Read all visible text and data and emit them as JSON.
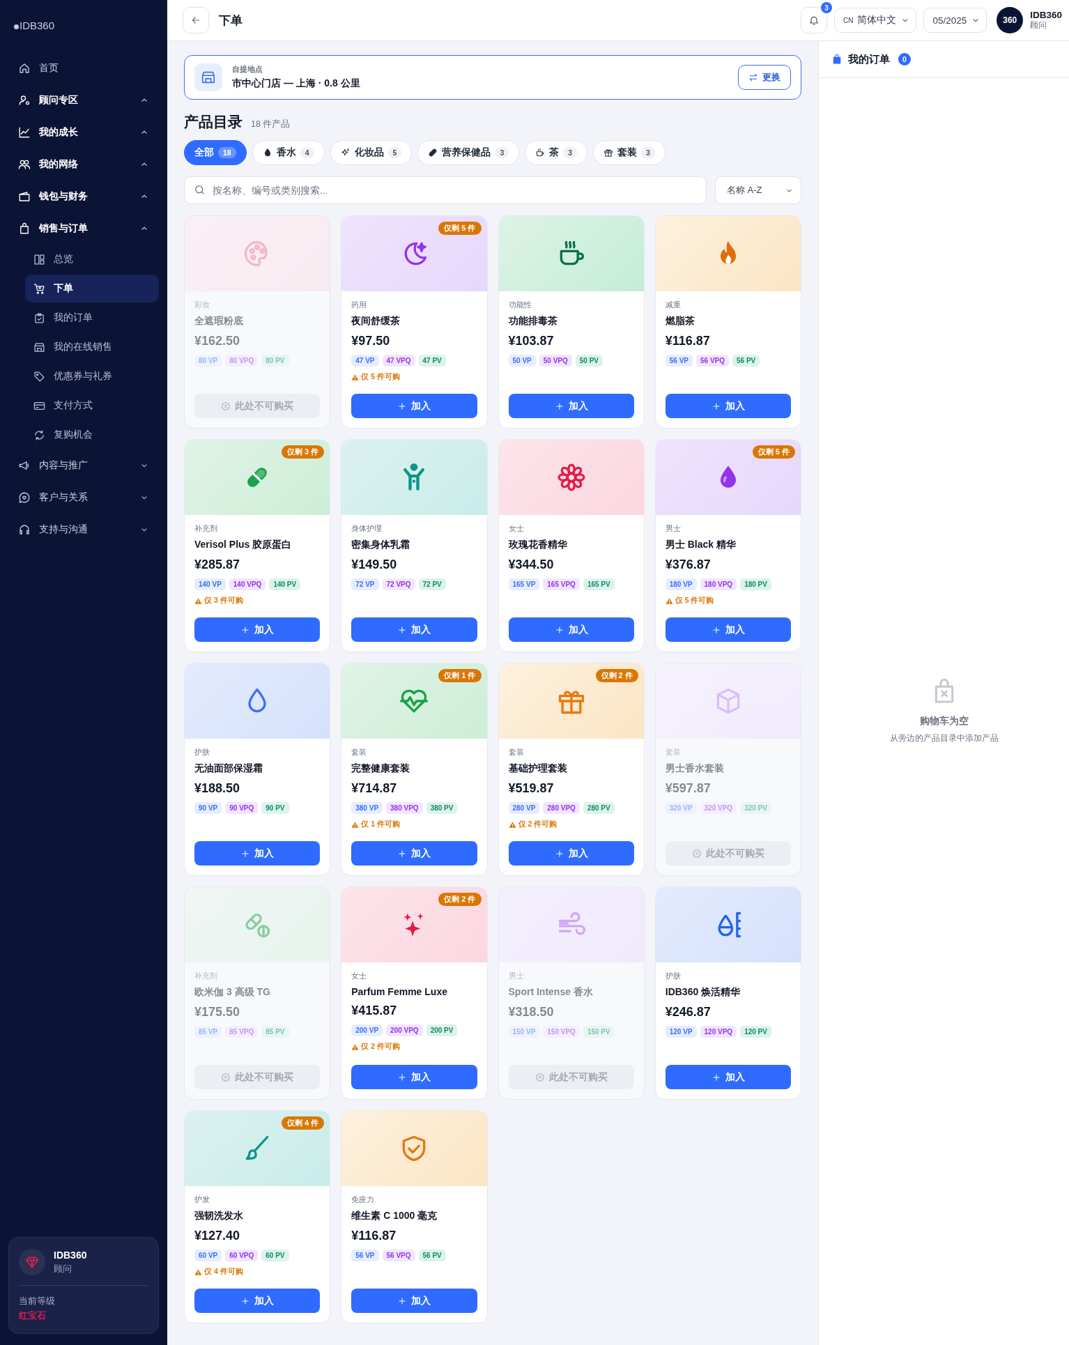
{
  "brand": "IDB360",
  "nav": [
    {
      "label": "首页",
      "kind": "link"
    },
    {
      "label": "顾问专区",
      "kind": "group",
      "expanded": true
    },
    {
      "label": "我的成长",
      "kind": "group",
      "expanded": true
    },
    {
      "label": "我的网络",
      "kind": "group",
      "expanded": true
    },
    {
      "label": "钱包与财务",
      "kind": "group",
      "expanded": true
    },
    {
      "label": "销售与订单",
      "kind": "group",
      "expanded": true,
      "children": [
        {
          "label": "总览",
          "selected": false
        },
        {
          "label": "下单",
          "selected": true
        },
        {
          "label": "我的订单",
          "selected": false
        },
        {
          "label": "我的在线销售",
          "selected": false
        },
        {
          "label": "优惠券与礼券",
          "selected": false
        },
        {
          "label": "支付方式",
          "selected": false
        },
        {
          "label": "复购机会",
          "selected": false
        }
      ]
    },
    {
      "label": "内容与推广",
      "kind": "group",
      "expanded": false
    },
    {
      "label": "客户与关系",
      "kind": "group",
      "expanded": false
    },
    {
      "label": "支持与沟通",
      "kind": "group",
      "expanded": false
    }
  ],
  "profile": {
    "name": "IDB360",
    "role": "顾问",
    "level_label": "当前等级",
    "level": "红宝石"
  },
  "header": {
    "title": "下单",
    "notifications": "3",
    "language_code": "CN",
    "language": "简体中文",
    "period": "05/2025",
    "avatar": "360",
    "user": "IDB360",
    "user_role": "顾问"
  },
  "pickup": {
    "label": "自提地点",
    "location": "市中心门店 — 上海 · 0.8 公里",
    "button": "更换"
  },
  "catalog": {
    "title": "产品目录",
    "count": "18 件产品",
    "search_placeholder": "按名称、编号或类别搜索...",
    "sort": "名称 A-Z"
  },
  "filters": [
    {
      "label": "全部",
      "count": "18",
      "selected": true
    },
    {
      "label": "香水",
      "count": "4",
      "selected": false
    },
    {
      "label": "化妆品",
      "count": "5",
      "selected": false
    },
    {
      "label": "营养保健品",
      "count": "3",
      "selected": false
    },
    {
      "label": "茶",
      "count": "3",
      "selected": false
    },
    {
      "label": "套装",
      "count": "3",
      "selected": false
    }
  ],
  "products": [
    {
      "category": "彩妆",
      "name": "全遮瑕粉底",
      "price": "¥162.50",
      "vp": "80 VP",
      "vpq": "80 VPQ",
      "pv": "80 PV",
      "available": false,
      "button": "此处不可购买"
    },
    {
      "category": "药用",
      "name": "夜间舒缓茶",
      "price": "¥97.50",
      "vp": "47 VP",
      "vpq": "47 VPQ",
      "pv": "47 PV",
      "available": true,
      "badge": "仅剩 5 件",
      "warning": "仅 5 件可购",
      "button": "加入"
    },
    {
      "category": "功能性",
      "name": "功能排毒茶",
      "price": "¥103.87",
      "vp": "50 VP",
      "vpq": "50 VPQ",
      "pv": "50 PV",
      "available": true,
      "button": "加入"
    },
    {
      "category": "减重",
      "name": "燃脂茶",
      "price": "¥116.87",
      "vp": "56 VP",
      "vpq": "56 VPQ",
      "pv": "56 PV",
      "available": true,
      "button": "加入"
    },
    {
      "category": "补充剂",
      "name": "Verisol Plus 胶原蛋白",
      "price": "¥285.87",
      "vp": "140 VP",
      "vpq": "140 VPQ",
      "pv": "140 PV",
      "available": true,
      "badge": "仅剩 3 件",
      "warning": "仅 3 件可购",
      "button": "加入"
    },
    {
      "category": "身体护理",
      "name": "密集身体乳霜",
      "price": "¥149.50",
      "vp": "72 VP",
      "vpq": "72 VPQ",
      "pv": "72 PV",
      "available": true,
      "button": "加入"
    },
    {
      "category": "女士",
      "name": "玫瑰花香精华",
      "price": "¥344.50",
      "vp": "165 VP",
      "vpq": "165 VPQ",
      "pv": "165 PV",
      "available": true,
      "button": "加入"
    },
    {
      "category": "男士",
      "name": "男士 Black 精华",
      "price": "¥376.87",
      "vp": "180 VP",
      "vpq": "180 VPQ",
      "pv": "180 PV",
      "available": true,
      "badge": "仅剩 5 件",
      "warning": "仅 5 件可购",
      "button": "加入"
    },
    {
      "category": "护肤",
      "name": "无油面部保湿霜",
      "price": "¥188.50",
      "vp": "90 VP",
      "vpq": "90 VPQ",
      "pv": "90 PV",
      "available": true,
      "button": "加入"
    },
    {
      "category": "套装",
      "name": "完整健康套装",
      "price": "¥714.87",
      "vp": "380 VP",
      "vpq": "380 VPQ",
      "pv": "380 PV",
      "available": true,
      "badge": "仅剩 1 件",
      "warning": "仅 1 件可购",
      "button": "加入"
    },
    {
      "category": "套装",
      "name": "基础护理套装",
      "price": "¥519.87",
      "vp": "280 VP",
      "vpq": "280 VPQ",
      "pv": "280 PV",
      "available": true,
      "badge": "仅剩 2 件",
      "warning": "仅 2 件可购",
      "button": "加入"
    },
    {
      "category": "套装",
      "name": "男士香水套装",
      "price": "¥597.87",
      "vp": "320 VP",
      "vpq": "320 VPQ",
      "pv": "320 PV",
      "available": false,
      "button": "此处不可购买"
    },
    {
      "category": "补充剂",
      "name": "欧米伽 3 高级 TG",
      "price": "¥175.50",
      "vp": "85 VP",
      "vpq": "85 VPQ",
      "pv": "85 PV",
      "available": false,
      "button": "此处不可购买"
    },
    {
      "category": "女士",
      "name": "Parfum Femme Luxe",
      "price": "¥415.87",
      "vp": "200 VP",
      "vpq": "200 VPQ",
      "pv": "200 PV",
      "available": true,
      "badge": "仅剩 2 件",
      "warning": "仅 2 件可购",
      "button": "加入"
    },
    {
      "category": "男士",
      "name": "Sport Intense 香水",
      "price": "¥318.50",
      "vp": "150 VP",
      "vpq": "150 VPQ",
      "pv": "150 PV",
      "available": false,
      "button": "此处不可购买"
    },
    {
      "category": "护肤",
      "name": "IDB360 焕活精华",
      "price": "¥246.87",
      "vp": "120 VP",
      "vpq": "120 VPQ",
      "pv": "120 PV",
      "available": true,
      "button": "加入"
    },
    {
      "category": "护发",
      "name": "强韧洗发水",
      "price": "¥127.40",
      "vp": "60 VP",
      "vpq": "60 VPQ",
      "pv": "60 PV",
      "available": true,
      "badge": "仅剩 4 件",
      "warning": "仅 4 件可购",
      "button": "加入"
    },
    {
      "category": "免疫力",
      "name": "维生素 C 1000 毫克",
      "price": "¥116.87",
      "vp": "56 VP",
      "vpq": "56 VPQ",
      "pv": "56 PV",
      "available": true,
      "button": "加入"
    }
  ],
  "cart": {
    "title": "我的订单",
    "count": "0",
    "empty_title": "购物车为空",
    "empty_hint": "从旁边的产品目录中添加产品"
  }
}
